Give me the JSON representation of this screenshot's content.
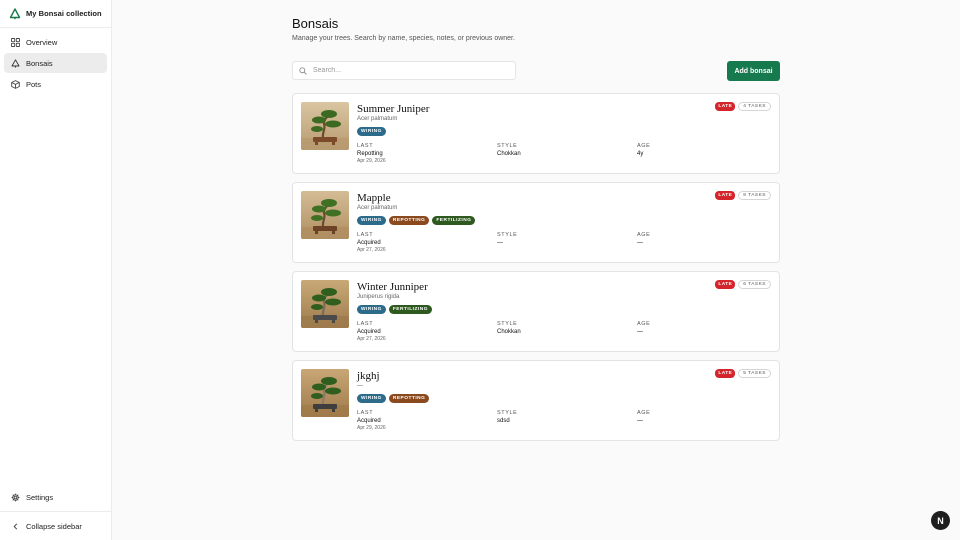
{
  "app": {
    "title": "My Bonsai collection"
  },
  "sidebar": {
    "items": [
      {
        "label": "Overview",
        "icon": "grid-icon"
      },
      {
        "label": "Bonsais",
        "icon": "tree-icon",
        "active": true
      },
      {
        "label": "Pots",
        "icon": "box-icon"
      }
    ],
    "settings_label": "Settings",
    "collapse_label": "Collapse sidebar"
  },
  "main": {
    "title": "Bonsais",
    "subtitle": "Manage your trees. Search by name, species, notes, or previous owner.",
    "search_placeholder": "Search...",
    "add_button": "Add bonsai",
    "field_labels": {
      "last": "LAST",
      "style": "STYLE",
      "age": "AGE"
    },
    "late_label": "LATE",
    "tag_colors": {
      "wiring": "#2d6b8a",
      "repotting": "#8a4a1e",
      "fertilizing": "#2f5a1f"
    },
    "accent_color": "#167a4e",
    "late_color": "#d3252b",
    "cards": [
      {
        "name": "Summer Juniper",
        "species": "Acer palmatum",
        "tags": [
          "WIRING"
        ],
        "last_value": "Repotting",
        "last_date": "Apr 29, 2026",
        "style": "Chokkan",
        "age": "4y",
        "tasks": "4 TASKS"
      },
      {
        "name": "Mapple",
        "species": "Acer palmatum",
        "tags": [
          "WIRING",
          "REPOTTING",
          "FERTILIZING"
        ],
        "last_value": "Acquired",
        "last_date": "Apr 27, 2026",
        "style": "—",
        "age": "—",
        "tasks": "8 TASKS"
      },
      {
        "name": "Winter Junniper",
        "species": "Juniperus rigida",
        "tags": [
          "WIRING",
          "FERTILIZING"
        ],
        "last_value": "Acquired",
        "last_date": "Apr 27, 2026",
        "style": "Chokkan",
        "age": "—",
        "tasks": "6 TASKS"
      },
      {
        "name": "jkghj",
        "species": "—",
        "tags": [
          "WIRING",
          "REPOTTING"
        ],
        "last_value": "Acquired",
        "last_date": "Apr 29, 2026",
        "style": "sdsd",
        "age": "—",
        "tasks": "5 TASKS"
      }
    ]
  },
  "avatar": {
    "initial": "N"
  }
}
